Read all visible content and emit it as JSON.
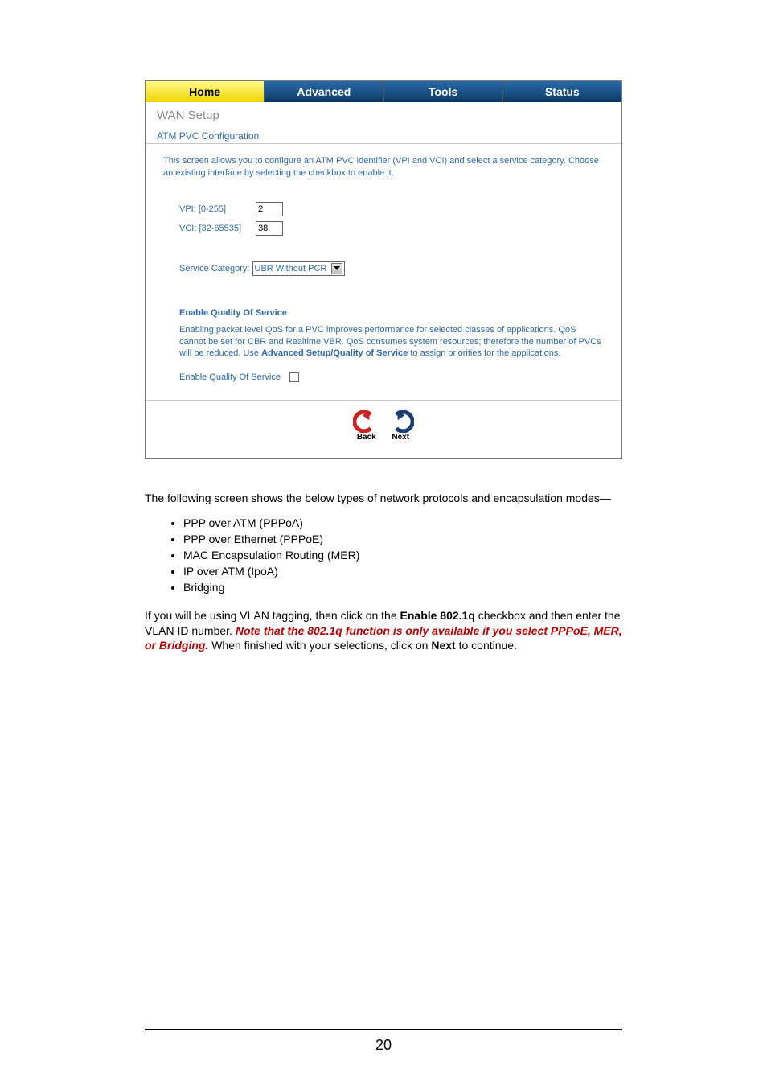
{
  "tabs": {
    "home": "Home",
    "advanced": "Advanced",
    "tools": "Tools",
    "status": "Status"
  },
  "section_title": "WAN Setup",
  "subsection_title": "ATM PVC Configuration",
  "description": "This screen allows you to configure an ATM PVC identifier (VPI and VCI) and select a service category. Choose an existing interface by selecting the checkbox to enable it.",
  "fields": {
    "vpi_label": "VPI: [0-255]",
    "vpi_value": "2",
    "vci_label": "VCI: [32-65535]",
    "vci_value": "38",
    "service_label": "Service Category:",
    "service_value": "UBR Without PCR"
  },
  "qos": {
    "heading": "Enable Quality Of Service",
    "text1": "Enabling packet level QoS for a PVC improves performance for selected classes of applications.  QoS cannot be set for CBR and Realtime VBR.  QoS consumes system resources; therefore the number of PVCs will be reduced. Use ",
    "text_bold": "Advanced Setup/Quality of Service",
    "text2": " to assign priorities for the applications.",
    "enable_label": "Enable Quality Of Service"
  },
  "nav": {
    "back": "Back",
    "next": "Next"
  },
  "body": {
    "p1": "The following screen shows the below types of network protocols and encapsulation modes—",
    "bullets": [
      "PPP over ATM (PPPoA)",
      "PPP over Ethernet (PPPoE)",
      "MAC Encapsulation Routing (MER)",
      "IP over ATM (IpoA)",
      "Bridging"
    ],
    "p2a": "If you will be using VLAN tagging, then click on the ",
    "p2b": "Enable 802.1q",
    "p2c": " checkbox and then enter the VLAN ID number. ",
    "p2_red": "Note that the 802.1q function is only available if you select PPPoE, MER, or Bridging.",
    "p2d": " When finished with your selections, click on ",
    "p2e": "Next",
    "p2f": " to continue."
  },
  "page_number": "20"
}
